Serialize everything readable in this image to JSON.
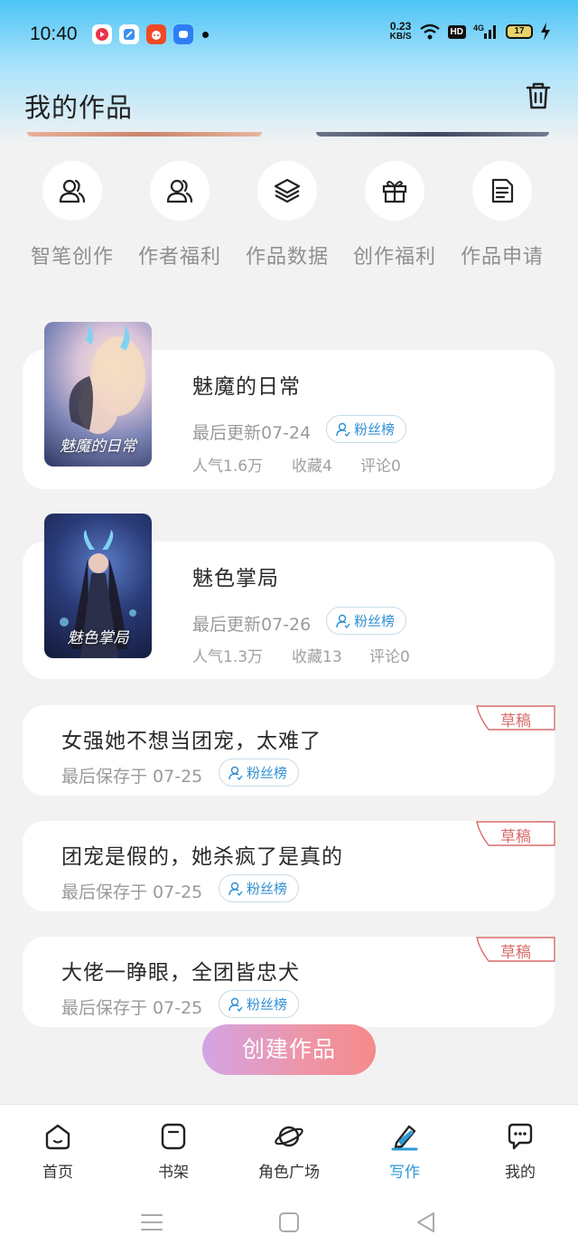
{
  "status_bar": {
    "time": "10:40",
    "net_speed_value": "0.23",
    "net_speed_unit": "KB/S",
    "hd": "HD",
    "network": "4G",
    "battery": "17"
  },
  "header": {
    "title": "我的作品"
  },
  "quick_actions": [
    {
      "label": "智笔创作",
      "icon": "users-icon"
    },
    {
      "label": "作者福利",
      "icon": "users-icon"
    },
    {
      "label": "作品数据",
      "icon": "layers-icon"
    },
    {
      "label": "创作福利",
      "icon": "gift-icon"
    },
    {
      "label": "作品申请",
      "icon": "document-icon"
    }
  ],
  "works": [
    {
      "title": "魅魔的日常",
      "cover_text": "魅魔的日常",
      "last_update": "最后更新07-24",
      "fans_label": "粉丝榜",
      "popularity": "人气1.6万",
      "favorites": "收藏4",
      "comments": "评论0"
    },
    {
      "title": "魅色掌局",
      "cover_text": "魅色掌局",
      "last_update": "最后更新07-26",
      "fans_label": "粉丝榜",
      "popularity": "人气1.3万",
      "favorites": "收藏13",
      "comments": "评论0"
    }
  ],
  "drafts": [
    {
      "title": "女强她不想当团宠，太难了",
      "saved": "最后保存于 07-25",
      "fans_label": "粉丝榜",
      "tag": "草稿"
    },
    {
      "title": "团宠是假的，她杀疯了是真的",
      "saved": "最后保存于 07-25",
      "fans_label": "粉丝榜",
      "tag": "草稿"
    },
    {
      "title": "大佬一睁眼，全团皆忠犬",
      "saved": "最后保存于 07-25",
      "fans_label": "粉丝榜",
      "tag": "草稿"
    }
  ],
  "create_button": "创建作品",
  "tab_bar": [
    {
      "label": "首页",
      "icon": "home-icon"
    },
    {
      "label": "书架",
      "icon": "bookshelf-icon"
    },
    {
      "label": "角色广场",
      "icon": "planet-icon"
    },
    {
      "label": "写作",
      "icon": "pen-icon",
      "active": true
    },
    {
      "label": "我的",
      "icon": "chat-icon"
    }
  ],
  "colors": {
    "accent": "#2e9ad6",
    "draft_tag": "#d96b6b"
  }
}
